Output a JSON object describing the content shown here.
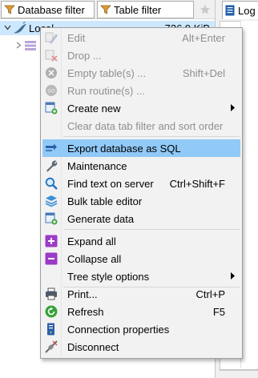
{
  "filters": {
    "database_filter_placeholder": "Database filter",
    "table_filter_placeholder": "Table filter"
  },
  "tree": {
    "selected_node_label": "Local",
    "selected_node_size": "736,9 KiB"
  },
  "right_tab": {
    "label": "Log"
  },
  "menu": {
    "edit": {
      "label": "Edit",
      "shortcut": "Alt+Enter",
      "icon": "edit-icon"
    },
    "drop": {
      "label": "Drop ...",
      "icon": "drop-icon"
    },
    "empty_tables": {
      "label": "Empty table(s) ...",
      "shortcut": "Shift+Del",
      "icon": "empty-icon"
    },
    "run_routines": {
      "label": "Run routine(s) ...",
      "icon": "run-icon"
    },
    "create_new": {
      "label": "Create new",
      "icon": "create-new-icon"
    },
    "clear_filter": {
      "label": "Clear data tab filter and sort order"
    },
    "export_sql": {
      "label": "Export database as SQL",
      "icon": "export-icon"
    },
    "maintenance": {
      "label": "Maintenance",
      "icon": "wrench-icon"
    },
    "find_text": {
      "label": "Find text on server",
      "shortcut": "Ctrl+Shift+F",
      "icon": "magnifier-icon"
    },
    "bulk_editor": {
      "label": "Bulk table editor",
      "icon": "bulk-edit-icon"
    },
    "generate_data": {
      "label": "Generate data",
      "icon": "generate-icon"
    },
    "expand_all": {
      "label": "Expand all",
      "icon": "plus-icon"
    },
    "collapse_all": {
      "label": "Collapse all",
      "icon": "minus-icon"
    },
    "tree_style": {
      "label": "Tree style options"
    },
    "print": {
      "label": "Print...",
      "shortcut": "Ctrl+P",
      "icon": "printer-icon"
    },
    "refresh": {
      "label": "Refresh",
      "shortcut": "F5",
      "icon": "refresh-icon"
    },
    "connection_props": {
      "label": "Connection properties",
      "icon": "server-properties-icon"
    },
    "disconnect": {
      "label": "Disconnect",
      "icon": "disconnect-icon"
    }
  },
  "colors": {
    "highlight": "#91c9f7",
    "selection": "#cce8ff",
    "disabled_text": "#8f8f8f",
    "purple": "#9b3bc8"
  }
}
